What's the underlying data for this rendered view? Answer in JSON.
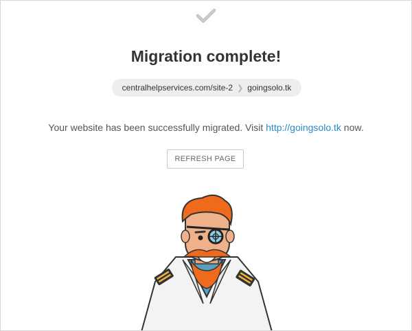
{
  "status": {
    "icon": "checkmark-icon",
    "title": "Migration complete!"
  },
  "breadcrumb": {
    "source": "centralhelpservices.com/site-2",
    "separator_icon": "chevron-right-icon",
    "destination": "goingsolo.tk"
  },
  "message": {
    "prefix": "Your website has been successfully migrated. Visit ",
    "link_text": "http://goingsolo.tk",
    "suffix": " now."
  },
  "actions": {
    "refresh_label": "REFRESH PAGE"
  },
  "illustration": {
    "name": "pirate-captain-illustration"
  },
  "colors": {
    "link": "#2a89c9",
    "beard": "#f06a1e",
    "check": "#c9c9c9"
  }
}
